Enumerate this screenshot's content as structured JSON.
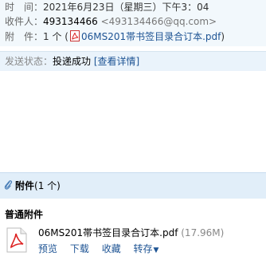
{
  "header": {
    "time_label": "时　间：",
    "time_value": "2021年6月23日（星期三）下午3：04",
    "recipient_label": "收件人：",
    "recipient_name": "493134466",
    "recipient_email": "<493134466@qq.com>",
    "attachment_label": "附　件：",
    "attachment_count": "1 个 (",
    "attachment_name": "06MS201帯书签目录合订本.pdf",
    "attachment_close": ")"
  },
  "status": {
    "label": "发送状态：",
    "value": "投递成功",
    "details_link": "[查看详情]"
  },
  "attachments": {
    "title": "附件",
    "count": "(1 个)",
    "section_label": "普通附件",
    "items": [
      {
        "filename": "06MS201帯书签目录合订本.pdf",
        "size": "(17.96M)",
        "actions": [
          "预览",
          "下载",
          "收藏",
          "转存"
        ]
      }
    ]
  },
  "colors": {
    "link": "#1e5494",
    "header_bg": "#f2f8fc",
    "attach_header_bg": "#e1eef9"
  },
  "icons": {
    "attachment_file": "pdf-icon",
    "attachment_section": "paperclip-icon",
    "dropdown": "chevron-down-icon"
  }
}
